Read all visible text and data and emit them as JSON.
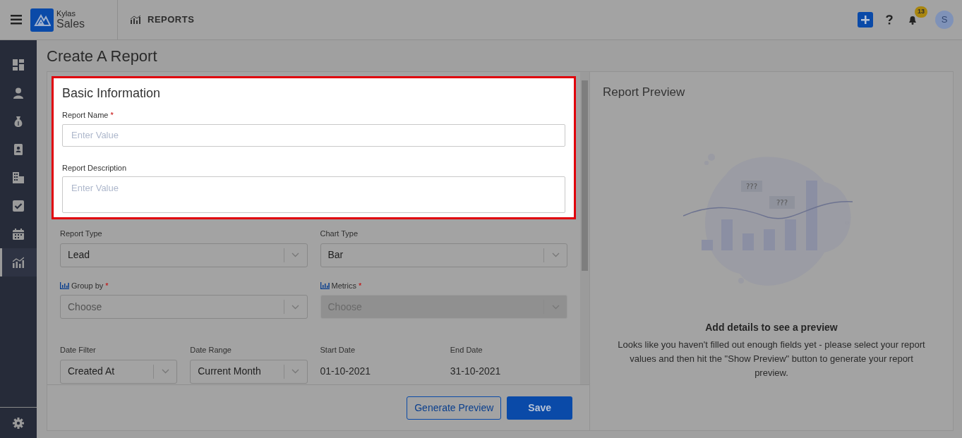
{
  "header": {
    "brand_top": "Kylas",
    "brand_bottom": "Sales",
    "section": "REPORTS",
    "notification_count": "13",
    "avatar_initial": "S"
  },
  "sidebar": {
    "items": [
      {
        "selected": false
      },
      {
        "selected": false
      },
      {
        "selected": false
      },
      {
        "selected": false
      },
      {
        "selected": false
      },
      {
        "selected": false
      },
      {
        "selected": false
      },
      {
        "selected": true
      }
    ]
  },
  "page_title": "Create A Report",
  "basic_information": {
    "title": "Basic Information",
    "highlighted": true,
    "fields": [
      {
        "label": "Report Name",
        "required_mark": "*",
        "placeholder": "Enter Value",
        "kind": "input"
      },
      {
        "label": "Report Description",
        "placeholder": "Enter Value",
        "kind": "textarea"
      }
    ]
  },
  "select_rows": [
    [
      {
        "label": "Report Type",
        "chart_icon": false,
        "value": "Lead",
        "disabled": false
      },
      {
        "label": "Chart Type",
        "chart_icon": false,
        "value": "Bar",
        "disabled": false
      }
    ],
    [
      {
        "label": "Group by",
        "required_mark": "*",
        "chart_icon": true,
        "placeholder": "Choose",
        "disabled": false
      },
      {
        "label": "Metrics",
        "required_mark": "*",
        "chart_icon": true,
        "placeholder": "Choose",
        "disabled": true
      }
    ]
  ],
  "date_fields": [
    {
      "kind": "select",
      "label": "Date Filter",
      "value": "Created At"
    },
    {
      "kind": "select",
      "label": "Date Range",
      "value": "Current Month"
    },
    {
      "kind": "text",
      "label": "Start Date",
      "value": "01-10-2021"
    },
    {
      "kind": "text",
      "label": "End Date",
      "value": "31-10-2021"
    }
  ],
  "buttons": [
    {
      "kind": "outline",
      "label": "Generate Preview"
    },
    {
      "kind": "primary",
      "label": "Save"
    }
  ],
  "preview": {
    "title": "Report Preview",
    "bubble_marks": [
      "???",
      "???"
    ],
    "heading": "Add details to see a preview",
    "message": "Looks like you haven't filled out enough fields yet - please select your report values and then hit the \"Show Preview\" button to generate your report preview."
  }
}
